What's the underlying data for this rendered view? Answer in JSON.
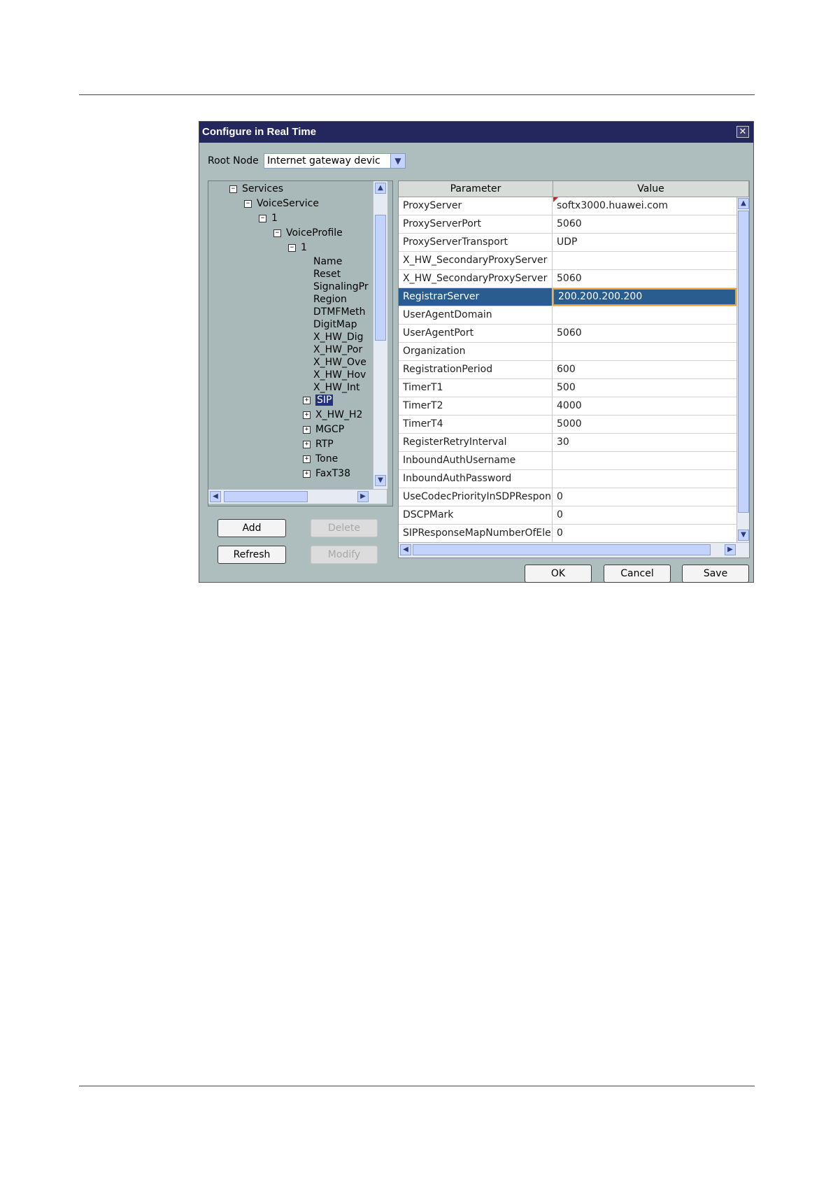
{
  "dialog": {
    "title": "Configure in Real Time",
    "close_glyph": "✕",
    "root_node_label": "Root Node",
    "root_node_value": "Internet gateway devic",
    "dropdown_icon": "chevron-down-icon"
  },
  "tree": {
    "collapse_glyph": "−",
    "expand_glyph": "+",
    "items": [
      {
        "label": "Services",
        "toggle": "collapse"
      },
      {
        "label": "VoiceService",
        "toggle": "collapse"
      },
      {
        "label": "1",
        "toggle": "collapse"
      },
      {
        "label": "VoiceProfile",
        "toggle": "collapse"
      },
      {
        "label": "1",
        "toggle": "collapse"
      },
      {
        "label": "Name",
        "toggle": "none"
      },
      {
        "label": "Reset",
        "toggle": "none"
      },
      {
        "label": "SignalingPr",
        "toggle": "none"
      },
      {
        "label": "Region",
        "toggle": "none"
      },
      {
        "label": "DTMFMeth",
        "toggle": "none"
      },
      {
        "label": "DigitMap",
        "toggle": "none"
      },
      {
        "label": "X_HW_Dig",
        "toggle": "none"
      },
      {
        "label": "X_HW_Por",
        "toggle": "none"
      },
      {
        "label": "X_HW_Ove",
        "toggle": "none"
      },
      {
        "label": "X_HW_Hov",
        "toggle": "none"
      },
      {
        "label": "X_HW_Int",
        "toggle": "none"
      },
      {
        "label": "SIP",
        "toggle": "expand",
        "selected": true
      },
      {
        "label": "X_HW_H2",
        "toggle": "expand"
      },
      {
        "label": "MGCP",
        "toggle": "expand"
      },
      {
        "label": "RTP",
        "toggle": "expand"
      },
      {
        "label": "Tone",
        "toggle": "expand"
      },
      {
        "label": "FaxT38",
        "toggle": "expand"
      }
    ]
  },
  "buttons": {
    "add": "Add",
    "delete": "Delete",
    "refresh": "Refresh",
    "modify": "Modify",
    "ok": "OK",
    "cancel": "Cancel",
    "save": "Save"
  },
  "grid": {
    "columns": [
      "Parameter",
      "Value"
    ],
    "rows": [
      {
        "param": "ProxyServer",
        "value": "softx3000.huawei.com",
        "marked": true
      },
      {
        "param": "ProxyServerPort",
        "value": "5060"
      },
      {
        "param": "ProxyServerTransport",
        "value": "UDP"
      },
      {
        "param": "X_HW_SecondaryProxyServer",
        "value": ""
      },
      {
        "param": "X_HW_SecondaryProxyServer",
        "value": "5060"
      },
      {
        "param": "RegistrarServer",
        "value": "200.200.200.200",
        "selected": true
      },
      {
        "param": "UserAgentDomain",
        "value": ""
      },
      {
        "param": "UserAgentPort",
        "value": "5060"
      },
      {
        "param": "Organization",
        "value": ""
      },
      {
        "param": "RegistrationPeriod",
        "value": "600"
      },
      {
        "param": "TimerT1",
        "value": "500"
      },
      {
        "param": "TimerT2",
        "value": "4000"
      },
      {
        "param": "TimerT4",
        "value": "5000"
      },
      {
        "param": "RegisterRetryInterval",
        "value": "30"
      },
      {
        "param": "InboundAuthUsername",
        "value": ""
      },
      {
        "param": "InboundAuthPassword",
        "value": ""
      },
      {
        "param": "UseCodecPriorityInSDPRespon",
        "value": "0"
      },
      {
        "param": "DSCPMark",
        "value": "0"
      },
      {
        "param": "SIPResponseMapNumberOfEle",
        "value": "0"
      }
    ]
  },
  "colors": {
    "titlebar": "#24265e",
    "dialog_bg": "#aebebe",
    "selection": "#2a5d8f",
    "selection_border": "#e8a030"
  }
}
